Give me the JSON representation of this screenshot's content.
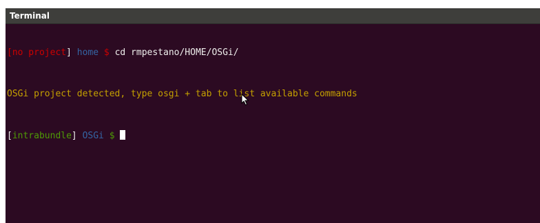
{
  "window": {
    "title": "Terminal"
  },
  "terminal": {
    "lines": [
      {
        "project_open": "[",
        "project": "no project",
        "project_close": "]",
        "dir": "home",
        "prompt": "$",
        "command": "cd rmpestano/HOME/OSGi/"
      },
      {
        "message": "OSGi project detected, type osgi + tab to list available commands"
      },
      {
        "project_open": "[",
        "project": "intrabundle",
        "project_close": "]",
        "dir": "OSGi",
        "prompt": "$"
      }
    ]
  },
  "colors": {
    "background": "#2c0a22",
    "titlebar": "#3e3e3b",
    "no_project": "#cc0000",
    "directory": "#3465a4",
    "message": "#c4a000",
    "project": "#4e9a06"
  },
  "icons": {
    "pointer": "mouse-pointer-icon"
  }
}
